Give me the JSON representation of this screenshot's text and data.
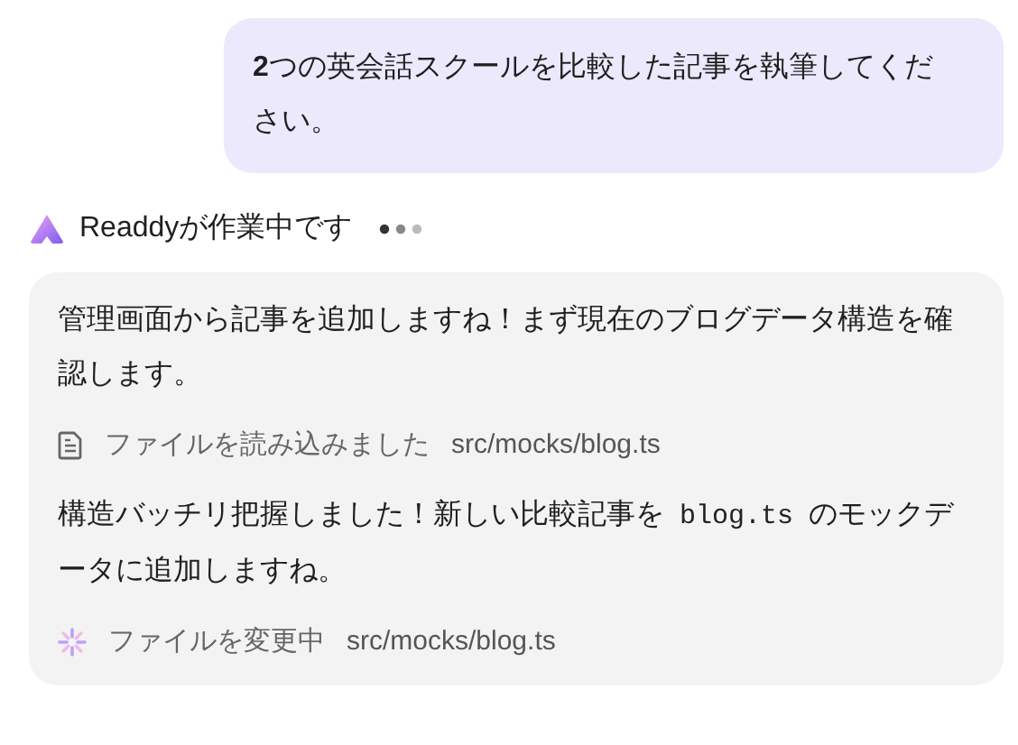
{
  "user_message": {
    "text": "**2**つの英会話スクールを比較した記事を執筆してください。"
  },
  "agent": {
    "name": "Readdyが作業中です",
    "working": true
  },
  "steps": [
    {
      "kind": "message",
      "segments": [
        {
          "kind": "text",
          "text": "管理画面から記事を追加しますね！まず現在のブログデータ構造を確認します。"
        }
      ]
    },
    {
      "kind": "action",
      "done": true,
      "label": "ファイルを読み込みました",
      "path": "src/mocks/blog.ts"
    },
    {
      "kind": "message",
      "segments": [
        {
          "kind": "text",
          "text": "構造バッチリ把握しました！新しい比較記事を "
        },
        {
          "kind": "code",
          "text": "blog.ts"
        },
        {
          "kind": "text",
          "text": " のモックデータに追加しますね。"
        }
      ]
    },
    {
      "kind": "action",
      "done": false,
      "label": "ファイルを変更中",
      "path": "src/mocks/blog.ts"
    }
  ]
}
